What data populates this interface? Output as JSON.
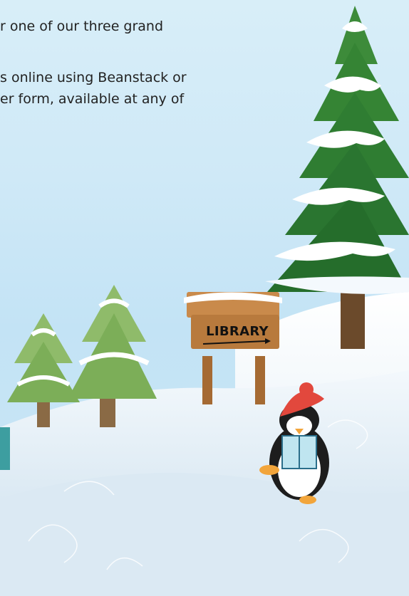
{
  "text_lines": [
    "r one of our three grand",
    "s online using Beanstack or",
    "er form, available at any of"
  ],
  "sign_label": "LIBRARY",
  "colors": {
    "sky_top": "#d8eef8",
    "snow": "#f4f9fd",
    "tree_dark": "#2f7d32",
    "tree_light": "#7cae58",
    "wood": "#b87a3d",
    "penguin_hat": "#e2483d"
  }
}
